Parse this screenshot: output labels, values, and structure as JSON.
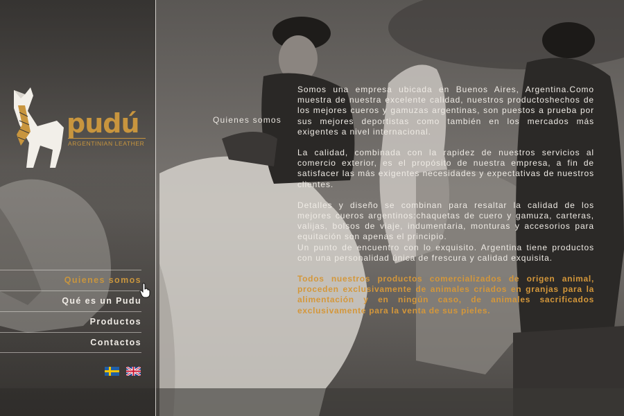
{
  "brand": {
    "name": "pudú",
    "tagline": "ARGENTINIAN LEATHER",
    "accent_color": "#c8953e"
  },
  "nav": {
    "items": [
      {
        "label": "Quienes somos",
        "active": true
      },
      {
        "label": "Qué es un Pudu",
        "active": false
      },
      {
        "label": "Productos",
        "active": false
      },
      {
        "label": "Contactos",
        "active": false
      }
    ]
  },
  "languages": [
    {
      "icon": "flag-sweden-icon"
    },
    {
      "icon": "flag-uk-icon"
    }
  ],
  "page": {
    "section_title": "Quienes somos",
    "paragraphs": [
      "Somos una empresa ubicada en Buenos Aires, Argentina.Como muestra de nuestra excelente calidad, nuestros productoshechos de los mejores cueros y gamuzas argentinas, son puestos a prueba por sus mejores deportistas como también en los mercados más exigentes a nivel internacional.",
      "La calidad, combinada con la rapidez de nuestros servicios al comercio exterior, es el propósito de nuestra empresa, a fin de satisfacer las más exigentes necesidades y expectativas de nuestros clientes.",
      "Detalles y diseño se combinan para resaltar la calidad de los mejores cueros argentinos:chaquetas de cuero y gamuza, carteras, valijas, bolsos de viaje, indumentaria, monturas y accesorios para equitación son apenas el principio.",
      "Un punto de encuentro con lo exquisito. Argentina tiene productos con una personalidad única de frescura y calidad exquisita.",
      "Todos nuestros productos comercializados de origen animal, proceden exclusivamente de animales criados en granjas para la alimentación y en ningún caso, de animales sacrificados exclusivamente para la venta de sus pieles."
    ]
  }
}
